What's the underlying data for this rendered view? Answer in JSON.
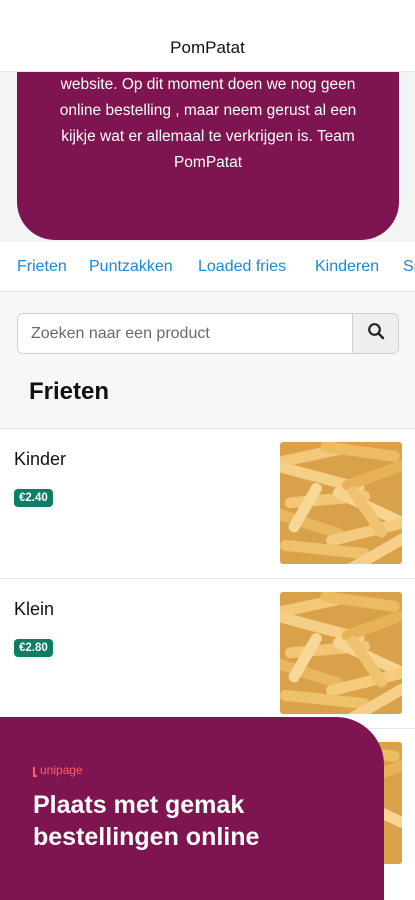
{
  "header": {
    "title": "PomPatat"
  },
  "hero": {
    "text": "website. Op dit moment doen we nog geen online bestelling , maar neem gerust al een kijkje wat er allemaal te verkrijgen is. Team PomPatat"
  },
  "categories": [
    "Frieten",
    "Puntzakken",
    "Loaded fries",
    "Kinderen",
    "Sn"
  ],
  "search": {
    "placeholder": "Zoeken naar een product"
  },
  "section": {
    "title": "Frieten"
  },
  "products": [
    {
      "name": "Kinder",
      "price": "€2.40"
    },
    {
      "name": "Klein",
      "price": "€2.80"
    }
  ],
  "promo": {
    "brand": "unipage",
    "headline": "Plaats met gemak bestellingen online"
  },
  "colors": {
    "brand": "#7f1550",
    "link": "#1f86d6",
    "price_badge": "#0e7d66",
    "promo_accent": "#ff5c6e"
  },
  "icons": {
    "search": "search-icon"
  }
}
